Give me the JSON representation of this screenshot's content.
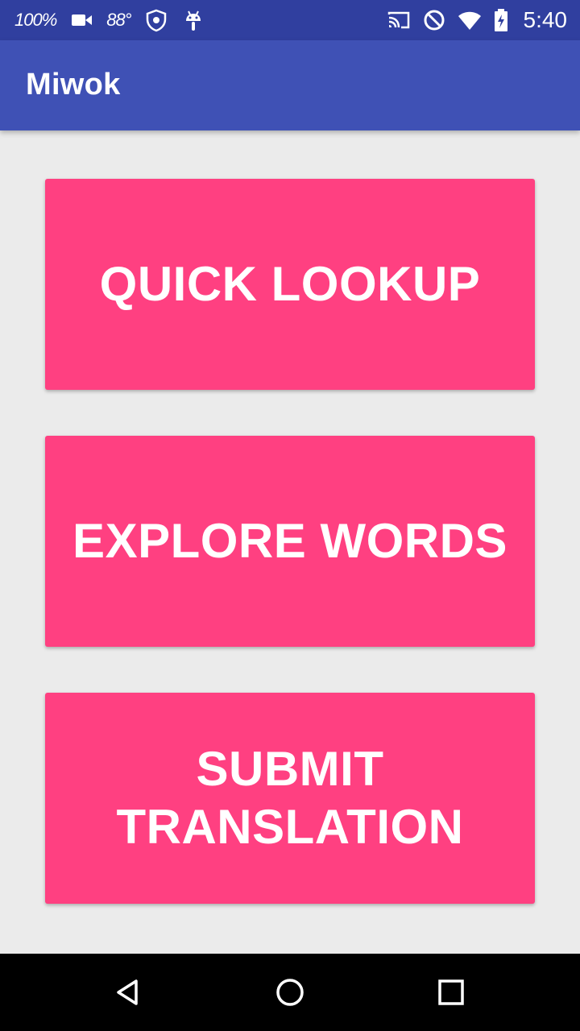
{
  "status_bar": {
    "battery_percent": "100%",
    "temperature": "88°",
    "time": "5:40",
    "icons": [
      "battery-percent-text",
      "video-camera-icon",
      "temperature-text",
      "shield-icon",
      "android-icon",
      "cast-icon",
      "do-not-disturb-icon",
      "wifi-icon",
      "battery-charging-icon"
    ]
  },
  "app_bar": {
    "title": "Miwok",
    "color": "#3f51b5"
  },
  "buttons": [
    {
      "label": "QUICK LOOKUP"
    },
    {
      "label": "EXPLORE WORDS"
    },
    {
      "label": "SUBMIT\nTRANSLATION"
    }
  ],
  "nav_bar": {
    "icons": [
      "back-triangle-icon",
      "home-circle-icon",
      "recents-square-icon"
    ]
  },
  "colors": {
    "status_bar": "#303f9f",
    "app_bar": "#3f51b5",
    "accent": "#ff4081",
    "background": "#ebebeb",
    "nav_bar": "#000000"
  }
}
